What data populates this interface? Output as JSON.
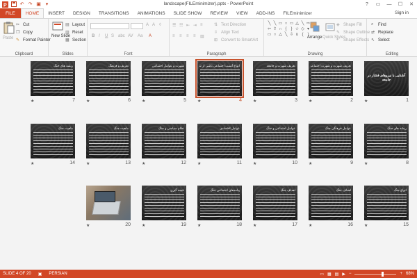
{
  "window": {
    "title": "landscape(FILEminimizer).pptx - PowerPoint",
    "controls": [
      "?",
      "▭",
      "—",
      "☐",
      "✕"
    ]
  },
  "tabs": {
    "file": "FILE",
    "items": [
      "HOME",
      "INSERT",
      "DESIGN",
      "TRANSITIONS",
      "ANIMATIONS",
      "SLIDE SHOW",
      "REVIEW",
      "VIEW",
      "ADD-INS",
      "FILEminimizer"
    ],
    "active": "HOME",
    "signin": "Sign in"
  },
  "ribbon": {
    "clipboard": {
      "label": "Clipboard",
      "paste": "Paste",
      "cut": "Cut",
      "copy": "Copy",
      "format_painter": "Format Painter"
    },
    "slides": {
      "label": "Slides",
      "new_slide": "New Slide",
      "layout": "Layout",
      "reset": "Reset",
      "section": "Section"
    },
    "font": {
      "label": "Font"
    },
    "paragraph": {
      "label": "Paragraph",
      "text_direction": "Text Direction",
      "align_text": "Align Text",
      "convert_smartart": "Convert to SmartArt"
    },
    "drawing": {
      "label": "Drawing",
      "arrange": "Arrange",
      "quick_styles": "Quick Styles",
      "shape_fill": "Shape Fill",
      "shape_outline": "Shape Outline",
      "shape_effects": "Shape Effects"
    },
    "editing": {
      "label": "Editing",
      "find": "Find",
      "replace": "Replace",
      "select": "Select"
    }
  },
  "slides": [
    {
      "num": "1",
      "title": "آشنایی با نیروهای فشار در جامعه",
      "kind": "title"
    },
    {
      "num": "2",
      "title": "تعریف شهرت و شهرت اجتماعی",
      "kind": "text"
    },
    {
      "num": "3",
      "title": "تعریف شهرت و جامعه",
      "kind": "text"
    },
    {
      "num": "4",
      "title": "انواع آسیب اجتماعی ناشی از شهرت",
      "kind": "text",
      "selected": true
    },
    {
      "num": "5",
      "title": "شهرت و عوامل اجتماعی",
      "kind": "text"
    },
    {
      "num": "6",
      "title": "تعریف و فرهنگ",
      "kind": "text"
    },
    {
      "num": "7",
      "title": "ریشه های جنگ",
      "kind": "text"
    },
    {
      "num": "8",
      "title": "ریشه های جنگ",
      "kind": "text"
    },
    {
      "num": "9",
      "title": "عوامل فرهنگی جنگ",
      "kind": "text"
    },
    {
      "num": "10",
      "title": "عوامل اجتماعی و جنگ",
      "kind": "text"
    },
    {
      "num": "11",
      "title": "عوامل اقتصادی",
      "kind": "text"
    },
    {
      "num": "12",
      "title": "نظام سیاسی و جنگ",
      "kind": "text"
    },
    {
      "num": "13",
      "title": "ماهیت جنگ",
      "kind": "text"
    },
    {
      "num": "14",
      "title": "ماهیت جنگ",
      "kind": "text"
    },
    {
      "num": "15",
      "title": "انواع جنگ",
      "kind": "text"
    },
    {
      "num": "16",
      "title": "اهداف جنگ",
      "kind": "text"
    },
    {
      "num": "17",
      "title": "اهداف جنگ",
      "kind": "text"
    },
    {
      "num": "18",
      "title": "پیامدهای اجتماعی جنگ",
      "kind": "text"
    },
    {
      "num": "19",
      "title": "نتیجه گیری",
      "kind": "text"
    },
    {
      "num": "20",
      "title": "",
      "kind": "photo"
    }
  ],
  "status": {
    "slide_of": "SLIDE 4 OF 20",
    "language": "PERSIAN",
    "zoom": "68%",
    "zoom_fraction": 0.68
  }
}
